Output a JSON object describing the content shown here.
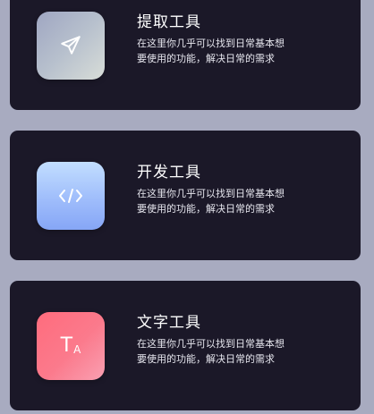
{
  "cards": [
    {
      "title": "提取工具",
      "description": "在这里你几乎可以找到日常基本想要使用的功能，解决日常的需求",
      "icon": "paper-plane-icon"
    },
    {
      "title": "开发工具",
      "description": "在这里你几乎可以找到日常基本想要使用的功能，解决日常的需求",
      "icon": "code-icon"
    },
    {
      "title": "文字工具",
      "description": "在这里你几乎可以找到日常基本想要使用的功能，解决日常的需求",
      "icon": "text-size-icon",
      "icon_text_big": "T",
      "icon_text_small": "A"
    }
  ],
  "colors": {
    "background": "#a8abc0",
    "card": "#1b1828",
    "extract_tile": "#b7c0cd",
    "dev_tile": "#9fbdfb",
    "text_tile": "#fb7a8c"
  }
}
